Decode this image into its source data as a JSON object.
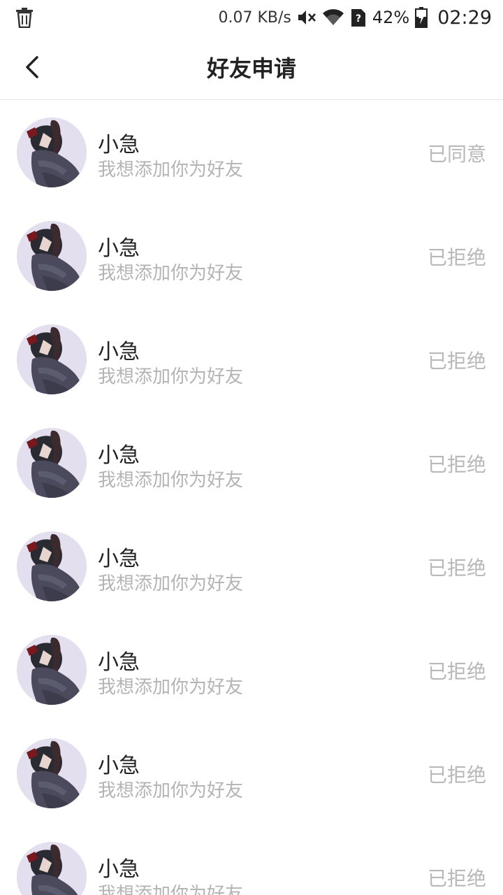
{
  "status_bar": {
    "net_speed": "0.07 KB/s",
    "battery": "42%",
    "time": "02:29",
    "icons": [
      "trash-icon",
      "mute-icon",
      "wifi-icon",
      "sim-unknown-icon",
      "battery-charging-icon"
    ]
  },
  "header": {
    "title": "好友申请",
    "back_icon": "chevron-left-icon"
  },
  "requests": [
    {
      "name": "小急",
      "message": "我想添加你为好友",
      "status": "已同意"
    },
    {
      "name": "小急",
      "message": "我想添加你为好友",
      "status": "已拒绝"
    },
    {
      "name": "小急",
      "message": "我想添加你为好友",
      "status": "已拒绝"
    },
    {
      "name": "小急",
      "message": "我想添加你为好友",
      "status": "已拒绝"
    },
    {
      "name": "小急",
      "message": "我想添加你为好友",
      "status": "已拒绝"
    },
    {
      "name": "小急",
      "message": "我想添加你为好友",
      "status": "已拒绝"
    },
    {
      "name": "小急",
      "message": "我想添加你为好友",
      "status": "已拒绝"
    },
    {
      "name": "小急",
      "message": "我想添加你为好友",
      "status": "已拒绝"
    }
  ],
  "colors": {
    "avatar_bg": "#e3dfee",
    "status_text": "#b8b8b8",
    "message_text": "#b4b4b4"
  }
}
